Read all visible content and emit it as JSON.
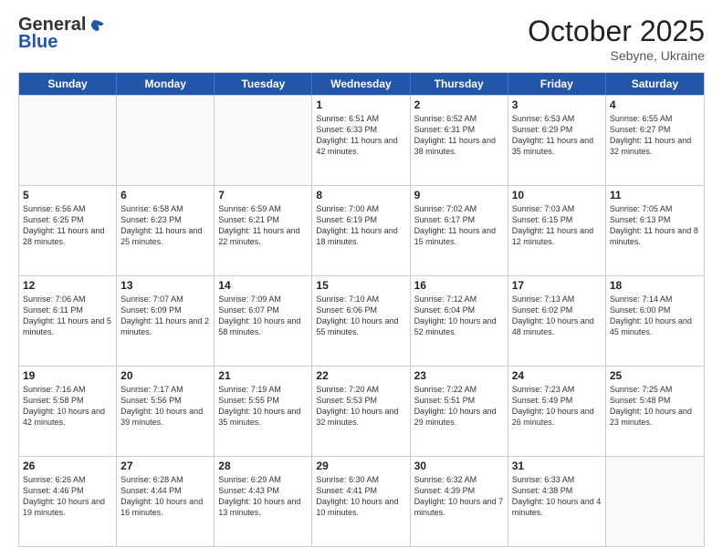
{
  "header": {
    "logo_general": "General",
    "logo_blue": "Blue",
    "month_title": "October 2025",
    "location": "Sebyne, Ukraine"
  },
  "days_of_week": [
    "Sunday",
    "Monday",
    "Tuesday",
    "Wednesday",
    "Thursday",
    "Friday",
    "Saturday"
  ],
  "rows": [
    [
      {
        "day": "",
        "empty": true
      },
      {
        "day": "",
        "empty": true
      },
      {
        "day": "",
        "empty": true
      },
      {
        "day": "1",
        "sunrise": "Sunrise: 6:51 AM",
        "sunset": "Sunset: 6:33 PM",
        "daylight": "Daylight: 11 hours and 42 minutes."
      },
      {
        "day": "2",
        "sunrise": "Sunrise: 6:52 AM",
        "sunset": "Sunset: 6:31 PM",
        "daylight": "Daylight: 11 hours and 38 minutes."
      },
      {
        "day": "3",
        "sunrise": "Sunrise: 6:53 AM",
        "sunset": "Sunset: 6:29 PM",
        "daylight": "Daylight: 11 hours and 35 minutes."
      },
      {
        "day": "4",
        "sunrise": "Sunrise: 6:55 AM",
        "sunset": "Sunset: 6:27 PM",
        "daylight": "Daylight: 11 hours and 32 minutes."
      }
    ],
    [
      {
        "day": "5",
        "sunrise": "Sunrise: 6:56 AM",
        "sunset": "Sunset: 6:25 PM",
        "daylight": "Daylight: 11 hours and 28 minutes."
      },
      {
        "day": "6",
        "sunrise": "Sunrise: 6:58 AM",
        "sunset": "Sunset: 6:23 PM",
        "daylight": "Daylight: 11 hours and 25 minutes."
      },
      {
        "day": "7",
        "sunrise": "Sunrise: 6:59 AM",
        "sunset": "Sunset: 6:21 PM",
        "daylight": "Daylight: 11 hours and 22 minutes."
      },
      {
        "day": "8",
        "sunrise": "Sunrise: 7:00 AM",
        "sunset": "Sunset: 6:19 PM",
        "daylight": "Daylight: 11 hours and 18 minutes."
      },
      {
        "day": "9",
        "sunrise": "Sunrise: 7:02 AM",
        "sunset": "Sunset: 6:17 PM",
        "daylight": "Daylight: 11 hours and 15 minutes."
      },
      {
        "day": "10",
        "sunrise": "Sunrise: 7:03 AM",
        "sunset": "Sunset: 6:15 PM",
        "daylight": "Daylight: 11 hours and 12 minutes."
      },
      {
        "day": "11",
        "sunrise": "Sunrise: 7:05 AM",
        "sunset": "Sunset: 6:13 PM",
        "daylight": "Daylight: 11 hours and 8 minutes."
      }
    ],
    [
      {
        "day": "12",
        "sunrise": "Sunrise: 7:06 AM",
        "sunset": "Sunset: 6:11 PM",
        "daylight": "Daylight: 11 hours and 5 minutes."
      },
      {
        "day": "13",
        "sunrise": "Sunrise: 7:07 AM",
        "sunset": "Sunset: 6:09 PM",
        "daylight": "Daylight: 11 hours and 2 minutes."
      },
      {
        "day": "14",
        "sunrise": "Sunrise: 7:09 AM",
        "sunset": "Sunset: 6:07 PM",
        "daylight": "Daylight: 10 hours and 58 minutes."
      },
      {
        "day": "15",
        "sunrise": "Sunrise: 7:10 AM",
        "sunset": "Sunset: 6:06 PM",
        "daylight": "Daylight: 10 hours and 55 minutes."
      },
      {
        "day": "16",
        "sunrise": "Sunrise: 7:12 AM",
        "sunset": "Sunset: 6:04 PM",
        "daylight": "Daylight: 10 hours and 52 minutes."
      },
      {
        "day": "17",
        "sunrise": "Sunrise: 7:13 AM",
        "sunset": "Sunset: 6:02 PM",
        "daylight": "Daylight: 10 hours and 48 minutes."
      },
      {
        "day": "18",
        "sunrise": "Sunrise: 7:14 AM",
        "sunset": "Sunset: 6:00 PM",
        "daylight": "Daylight: 10 hours and 45 minutes."
      }
    ],
    [
      {
        "day": "19",
        "sunrise": "Sunrise: 7:16 AM",
        "sunset": "Sunset: 5:58 PM",
        "daylight": "Daylight: 10 hours and 42 minutes."
      },
      {
        "day": "20",
        "sunrise": "Sunrise: 7:17 AM",
        "sunset": "Sunset: 5:56 PM",
        "daylight": "Daylight: 10 hours and 39 minutes."
      },
      {
        "day": "21",
        "sunrise": "Sunrise: 7:19 AM",
        "sunset": "Sunset: 5:55 PM",
        "daylight": "Daylight: 10 hours and 35 minutes."
      },
      {
        "day": "22",
        "sunrise": "Sunrise: 7:20 AM",
        "sunset": "Sunset: 5:53 PM",
        "daylight": "Daylight: 10 hours and 32 minutes."
      },
      {
        "day": "23",
        "sunrise": "Sunrise: 7:22 AM",
        "sunset": "Sunset: 5:51 PM",
        "daylight": "Daylight: 10 hours and 29 minutes."
      },
      {
        "day": "24",
        "sunrise": "Sunrise: 7:23 AM",
        "sunset": "Sunset: 5:49 PM",
        "daylight": "Daylight: 10 hours and 26 minutes."
      },
      {
        "day": "25",
        "sunrise": "Sunrise: 7:25 AM",
        "sunset": "Sunset: 5:48 PM",
        "daylight": "Daylight: 10 hours and 23 minutes."
      }
    ],
    [
      {
        "day": "26",
        "sunrise": "Sunrise: 6:26 AM",
        "sunset": "Sunset: 4:46 PM",
        "daylight": "Daylight: 10 hours and 19 minutes."
      },
      {
        "day": "27",
        "sunrise": "Sunrise: 6:28 AM",
        "sunset": "Sunset: 4:44 PM",
        "daylight": "Daylight: 10 hours and 16 minutes."
      },
      {
        "day": "28",
        "sunrise": "Sunrise: 6:29 AM",
        "sunset": "Sunset: 4:43 PM",
        "daylight": "Daylight: 10 hours and 13 minutes."
      },
      {
        "day": "29",
        "sunrise": "Sunrise: 6:30 AM",
        "sunset": "Sunset: 4:41 PM",
        "daylight": "Daylight: 10 hours and 10 minutes."
      },
      {
        "day": "30",
        "sunrise": "Sunrise: 6:32 AM",
        "sunset": "Sunset: 4:39 PM",
        "daylight": "Daylight: 10 hours and 7 minutes."
      },
      {
        "day": "31",
        "sunrise": "Sunrise: 6:33 AM",
        "sunset": "Sunset: 4:38 PM",
        "daylight": "Daylight: 10 hours and 4 minutes."
      },
      {
        "day": "",
        "empty": true
      }
    ]
  ]
}
